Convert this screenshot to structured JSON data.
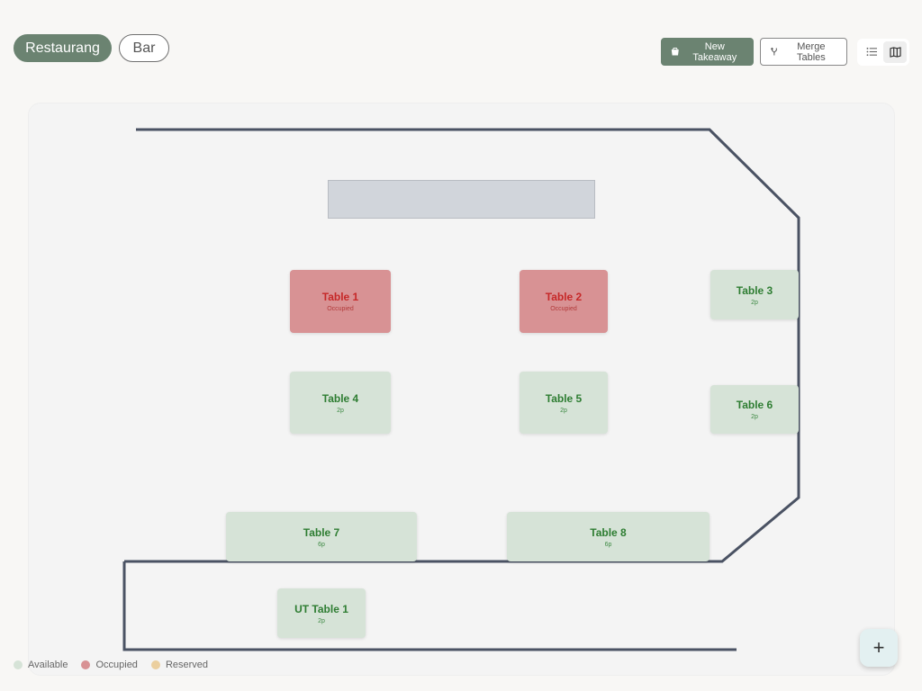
{
  "areas": {
    "tabs": [
      {
        "label": "Restaurang",
        "active": true
      },
      {
        "label": "Bar",
        "active": false
      }
    ]
  },
  "toolbar": {
    "new_takeaway_label": "New Takeaway",
    "new_takeaway_icon": "takeaway-bag-icon",
    "merge_tables_label": "Merge Tables",
    "merge_tables_icon": "merge-icon",
    "view_modes": [
      {
        "icon": "list-icon",
        "active": false
      },
      {
        "icon": "map-icon",
        "active": true
      }
    ]
  },
  "tables": [
    {
      "name": "Table 1",
      "sub": "Occupied",
      "status": "occupied"
    },
    {
      "name": "Table 2",
      "sub": "Occupied",
      "status": "occupied"
    },
    {
      "name": "Table 3",
      "sub": "2p",
      "status": "available"
    },
    {
      "name": "Table 4",
      "sub": "2p",
      "status": "available"
    },
    {
      "name": "Table 5",
      "sub": "2p",
      "status": "available"
    },
    {
      "name": "Table 6",
      "sub": "2p",
      "status": "available"
    },
    {
      "name": "Table 7",
      "sub": "6p",
      "status": "available"
    },
    {
      "name": "Table 8",
      "sub": "6p",
      "status": "available"
    },
    {
      "name": "UT Table 1",
      "sub": "2p",
      "status": "available"
    }
  ],
  "legend": [
    {
      "label": "Available",
      "color": "#d6e3d7"
    },
    {
      "label": "Occupied",
      "color": "#d89294"
    },
    {
      "label": "Reserved",
      "color": "#ebcf9f"
    }
  ],
  "colors": {
    "primary": "#6b8371",
    "available": "#d6e3d7",
    "occupied": "#d89294",
    "wall": "#4a5263"
  },
  "fab": {
    "label": "+",
    "icon": "plus-icon"
  }
}
